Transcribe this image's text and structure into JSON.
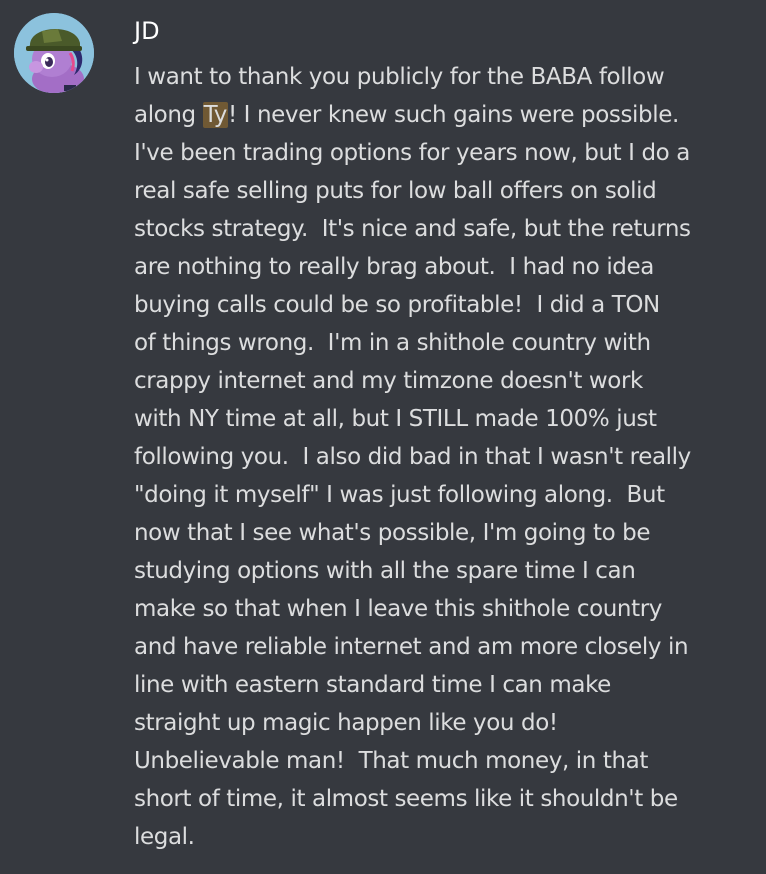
{
  "message": {
    "username": "JD",
    "avatar_icon": "pony-with-helmet-avatar",
    "mention": "Ty",
    "mention_color": "#faa61a",
    "lines": [
      "I want to thank you publicly for the BABA follow",
      "! I never knew such gains were possible.",
      "I've been trading options for years now, but I do a",
      "real safe selling puts for low ball offers on solid",
      "stocks strategy.  It's nice and safe, but the returns",
      "are nothing to really brag about.  I had no idea",
      "buying calls could be so profitable!  I did a TON",
      "of things wrong.  I'm in a shithole country with",
      "crappy internet and my timzone doesn't work",
      "with NY time at all, but I STILL made 100% just",
      "following you.  I also did bad in that I wasn't really",
      "\"doing it myself\" I was just following along.  But",
      "now that I see what's possible, I'm going to be",
      "studying options with all the spare time I can",
      "make so that when I leave this shithole country",
      "and have reliable internet and am more closely in",
      "line with eastern standard time I can make",
      "straight up magic happen like you do!",
      "Unbelievable man!  That much money, in that",
      "short of time, it almost seems like it shouldn't be",
      "legal."
    ],
    "line2_prefix": "along "
  }
}
